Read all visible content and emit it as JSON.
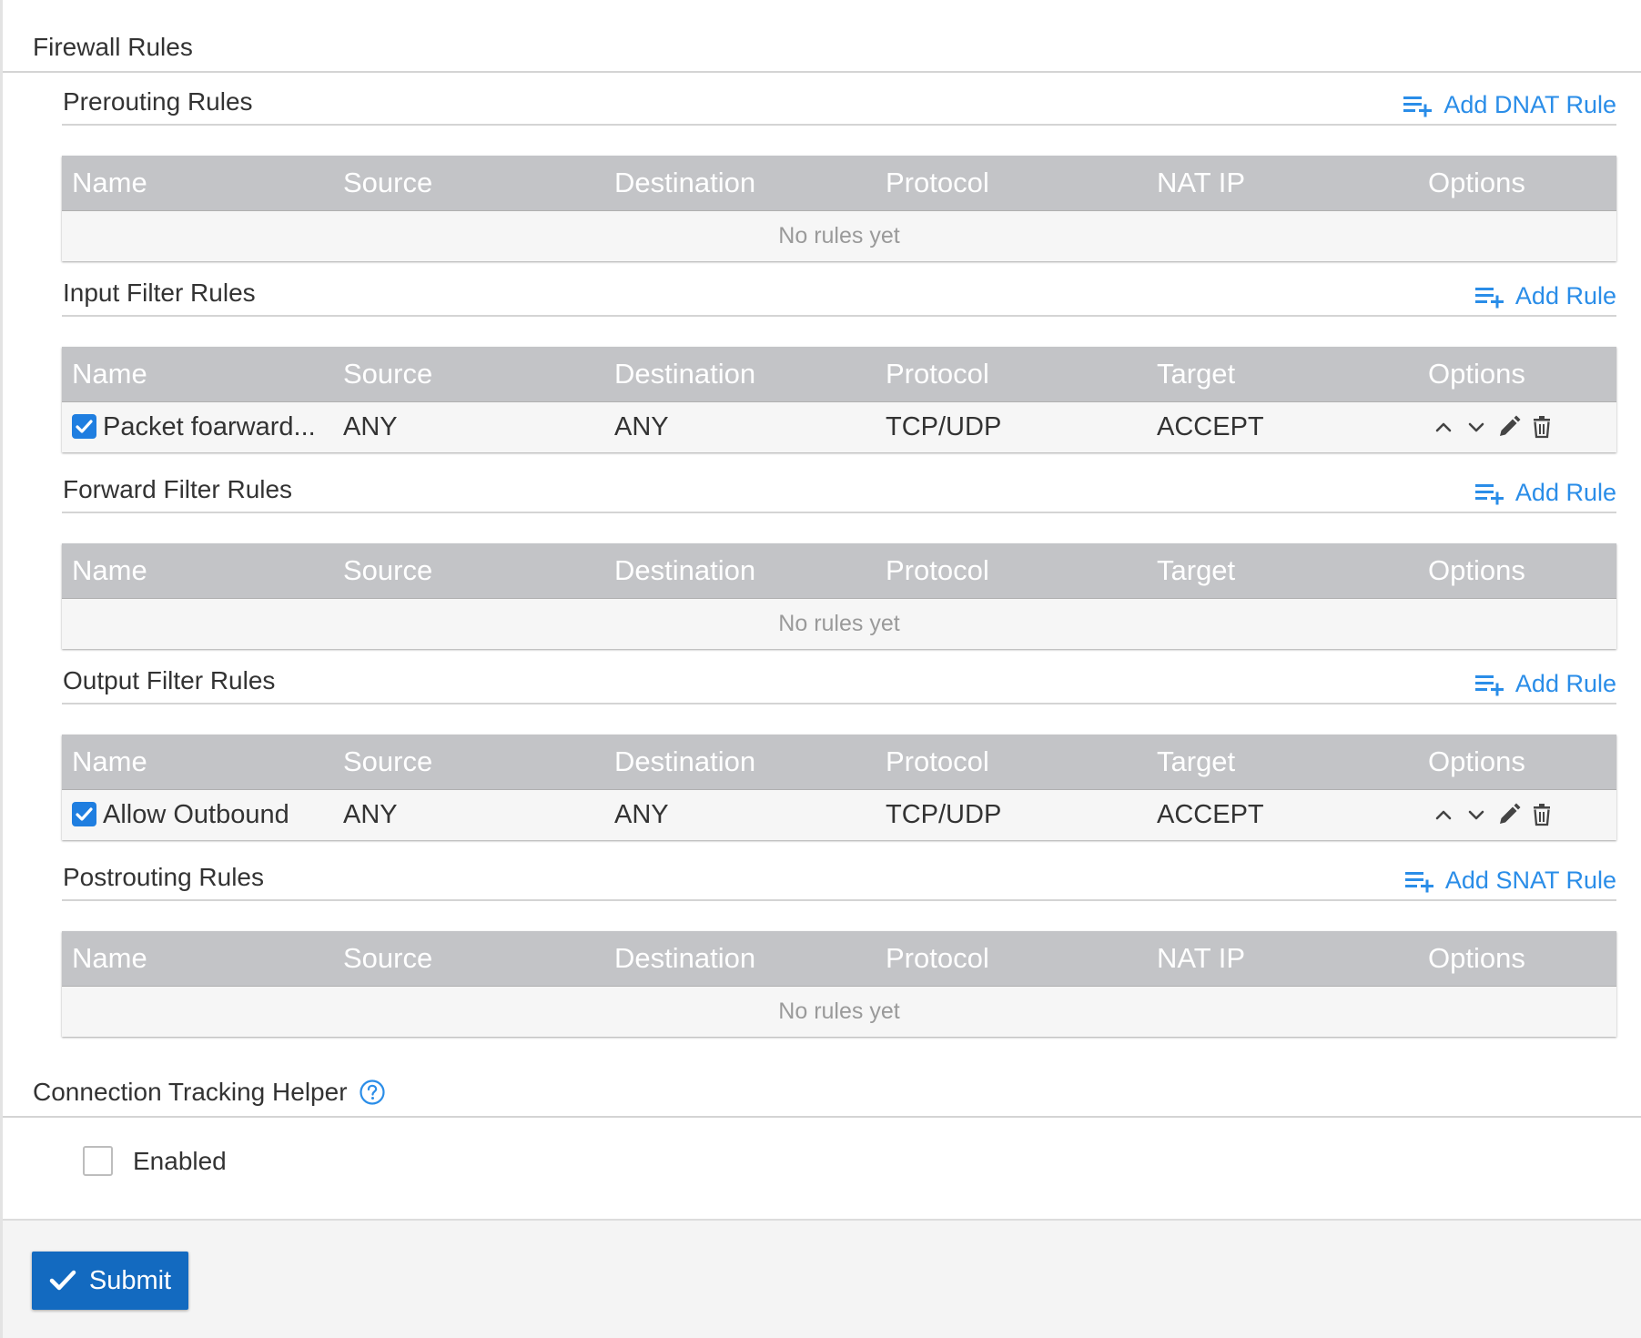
{
  "page": {
    "title": "Firewall Rules"
  },
  "sections": {
    "prerouting": {
      "title": "Prerouting Rules",
      "add_label": "Add DNAT Rule",
      "columns": [
        "Name",
        "Source",
        "Destination",
        "Protocol",
        "NAT IP",
        "Options"
      ],
      "empty": "No rules yet"
    },
    "input": {
      "title": "Input Filter Rules",
      "add_label": "Add Rule",
      "columns": [
        "Name",
        "Source",
        "Destination",
        "Protocol",
        "Target",
        "Options"
      ],
      "rows": [
        {
          "name": "Packet foarward...",
          "source": "ANY",
          "destination": "ANY",
          "protocol": "TCP/UDP",
          "target": "ACCEPT",
          "enabled": true
        }
      ]
    },
    "forward": {
      "title": "Forward Filter Rules",
      "add_label": "Add Rule",
      "columns": [
        "Name",
        "Source",
        "Destination",
        "Protocol",
        "Target",
        "Options"
      ],
      "empty": "No rules yet"
    },
    "output": {
      "title": "Output Filter Rules",
      "add_label": "Add Rule",
      "columns": [
        "Name",
        "Source",
        "Destination",
        "Protocol",
        "Target",
        "Options"
      ],
      "rows": [
        {
          "name": "Allow Outbound",
          "source": "ANY",
          "destination": "ANY",
          "protocol": "TCP/UDP",
          "target": "ACCEPT",
          "enabled": true
        }
      ]
    },
    "postrouting": {
      "title": "Postrouting Rules",
      "add_label": "Add SNAT Rule",
      "columns": [
        "Name",
        "Source",
        "Destination",
        "Protocol",
        "NAT IP",
        "Options"
      ],
      "empty": "No rules yet"
    }
  },
  "conntrack": {
    "title": "Connection Tracking Helper",
    "enabled_label": "Enabled",
    "enabled": false,
    "help_icon": "question-circle-icon"
  },
  "footer": {
    "submit_label": "Submit",
    "submit_icon": "checkmark-icon"
  },
  "colors": {
    "accent": "#2a8de8",
    "header_bg": "#c3c4c7",
    "button_bg": "#136ac0",
    "checkbox": "#1f7ee0"
  }
}
